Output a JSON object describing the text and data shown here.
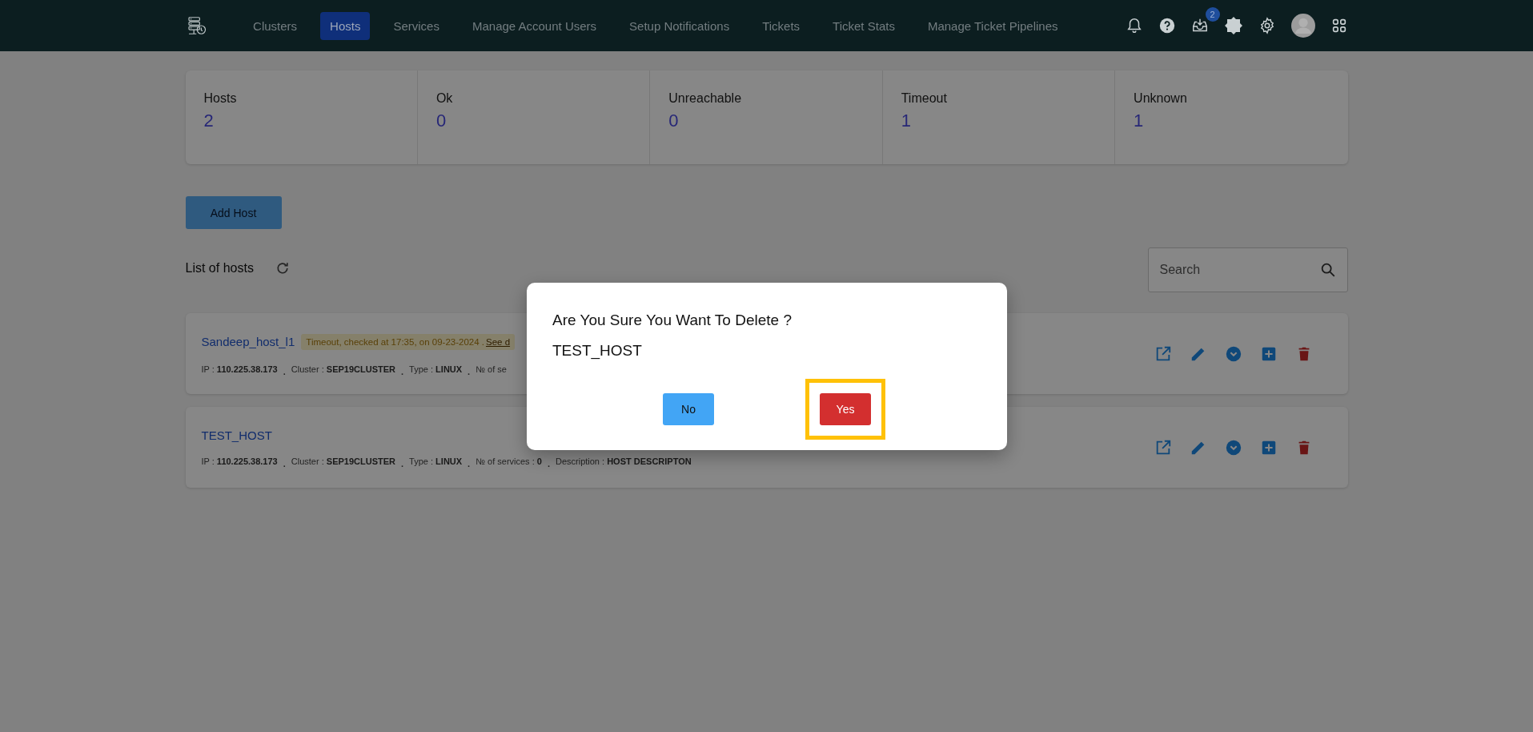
{
  "nav": {
    "items": [
      {
        "label": "Clusters",
        "selected": false
      },
      {
        "label": "Hosts",
        "selected": true
      },
      {
        "label": "Services",
        "selected": false
      },
      {
        "label": "Manage Account Users",
        "selected": false
      },
      {
        "label": "Setup Notifications",
        "selected": false
      },
      {
        "label": "Tickets",
        "selected": false
      },
      {
        "label": "Ticket Stats",
        "selected": false
      },
      {
        "label": "Manage Ticket Pipelines",
        "selected": false
      }
    ],
    "inbox_badge": "2"
  },
  "stats": [
    {
      "label": "Hosts",
      "value": "2"
    },
    {
      "label": "Ok",
      "value": "0"
    },
    {
      "label": "Unreachable",
      "value": "0"
    },
    {
      "label": "Timeout",
      "value": "1"
    },
    {
      "label": "Unknown",
      "value": "1"
    }
  ],
  "add_button": "Add Host",
  "list_title": "List of hosts",
  "search": {
    "placeholder": "Search"
  },
  "hosts": [
    {
      "name": "Sandeep_host_l1",
      "status": {
        "text": "Timeout, checked at 17:35, on 09-23-2024 .",
        "link": "See d"
      },
      "details": [
        {
          "label": "IP :",
          "value": "110.225.38.173"
        },
        {
          "sep": ".",
          "label": "Cluster :",
          "value": "SEP19CLUSTER"
        },
        {
          "sep": ".",
          "label": "Type :",
          "value": "LINUX"
        },
        {
          "sep": ".",
          "label": "№ of se"
        }
      ]
    },
    {
      "name": "TEST_HOST",
      "details": [
        {
          "label": "IP :",
          "value": "110.225.38.173"
        },
        {
          "sep": ".",
          "label": "Cluster :",
          "value": "SEP19CLUSTER"
        },
        {
          "sep": ".",
          "label": "Type :",
          "value": "LINUX"
        },
        {
          "sep": ".",
          "label": "№ of services :",
          "value": "0"
        },
        {
          "sep": ".",
          "label": "Description :",
          "value": "HOST DESCRIPTON"
        }
      ]
    }
  ],
  "dialog": {
    "title": "Are You Sure You Want To Delete ?",
    "subject": "TEST_HOST",
    "buttons": [
      {
        "label": "No",
        "kind": "cancel",
        "highlighted": false
      },
      {
        "label": "Yes",
        "kind": "confirm",
        "highlighted": true
      }
    ]
  }
}
